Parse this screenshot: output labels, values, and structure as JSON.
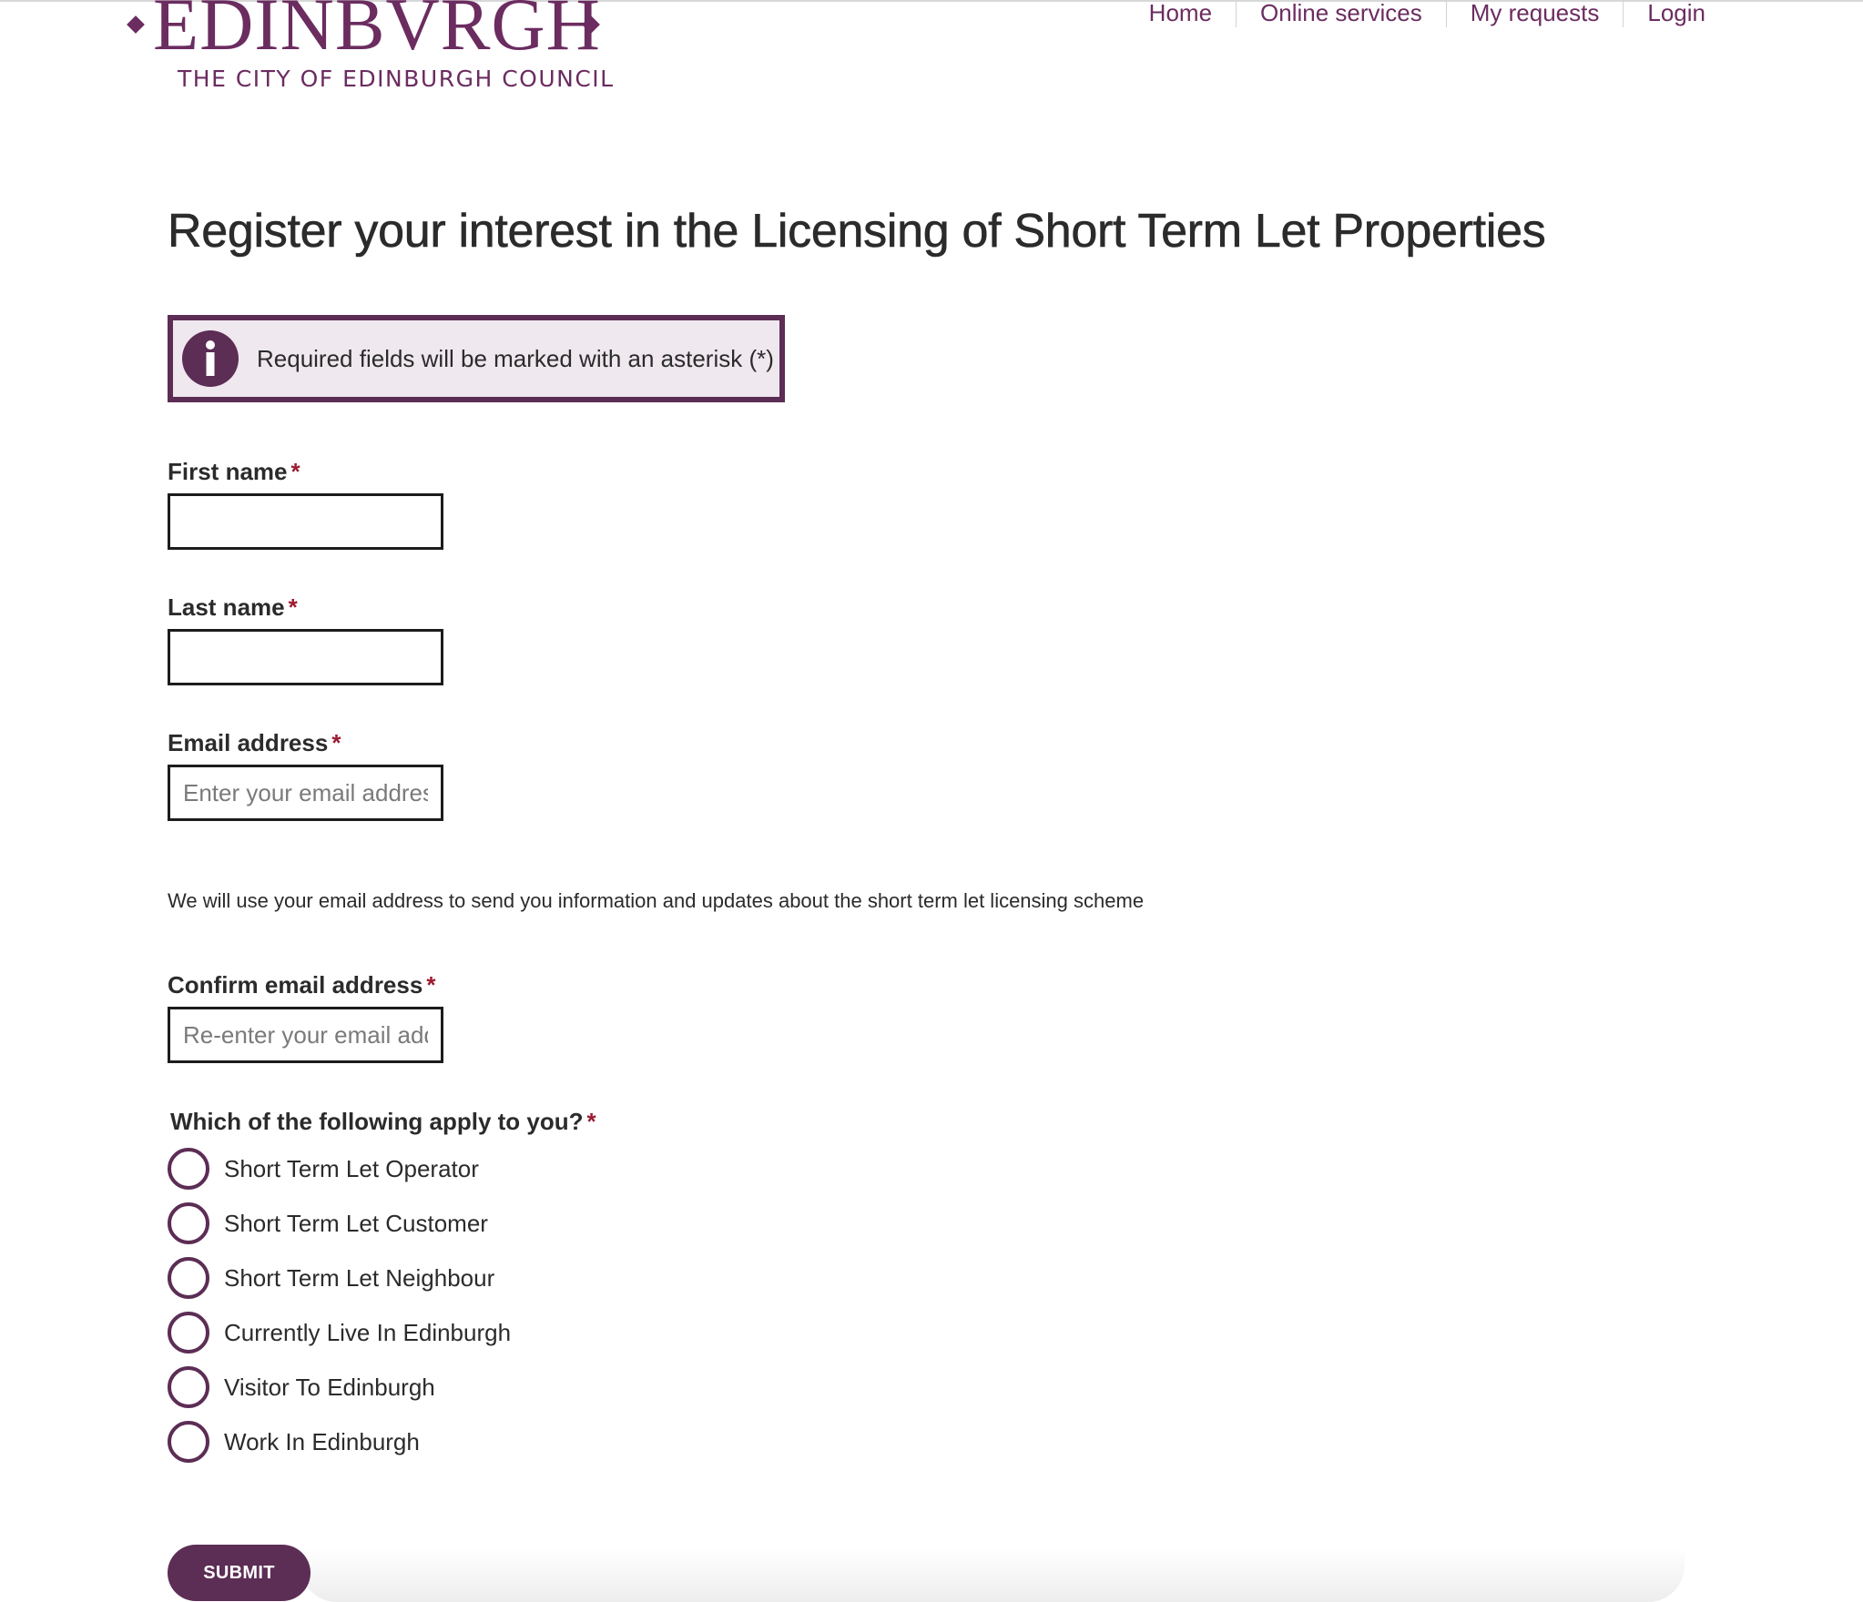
{
  "header": {
    "logo_wordmark": "EDINBVRGH",
    "logo_council": "THE CITY OF EDINBURGH COUNCIL",
    "nav": [
      {
        "label": "Home"
      },
      {
        "label": "Online services"
      },
      {
        "label": "My requests"
      },
      {
        "label": "Login"
      }
    ]
  },
  "page": {
    "title": "Register your interest in the Licensing of Short Term Let Properties",
    "info_message": "Required fields will be marked with an asterisk (*)",
    "required_marker": "*"
  },
  "form": {
    "first_name": {
      "label": "First name",
      "value": "",
      "placeholder": ""
    },
    "last_name": {
      "label": "Last name",
      "value": "",
      "placeholder": ""
    },
    "email": {
      "label": "Email address",
      "value": "",
      "placeholder": "Enter your email address"
    },
    "email_help": "We will use your email address to send you information and updates about the short term let licensing scheme",
    "confirm_email": {
      "label": "Confirm email address",
      "value": "",
      "placeholder": "Re-enter your email address"
    },
    "applies": {
      "label": "Which of the following apply to you?",
      "options": [
        {
          "label": "Short Term Let Operator",
          "selected": false
        },
        {
          "label": "Short Term Let Customer",
          "selected": false
        },
        {
          "label": "Short Term Let Neighbour",
          "selected": false
        },
        {
          "label": "Currently Live In Edinburgh",
          "selected": false
        },
        {
          "label": "Visitor To Edinburgh",
          "selected": false
        },
        {
          "label": "Work In Edinburgh",
          "selected": false
        }
      ]
    },
    "submit_label": "SUBMIT"
  },
  "colors": {
    "brand_purple": "#5c2d55",
    "link_purple": "#6b2c60",
    "required_red": "#9b1b30",
    "info_background": "#efe8ee"
  }
}
